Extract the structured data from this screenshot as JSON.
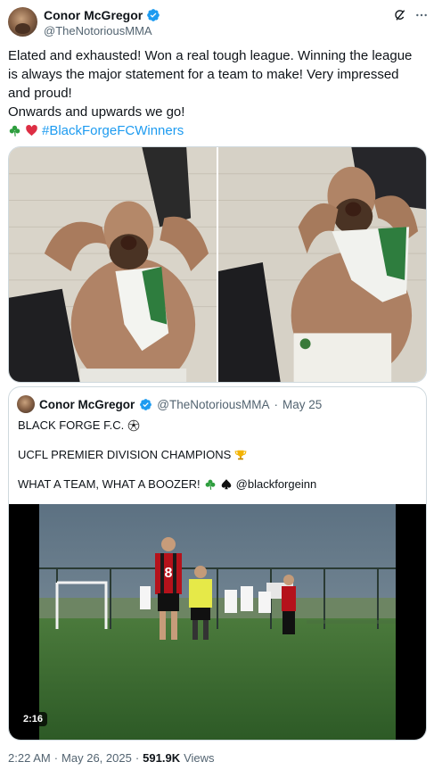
{
  "author": {
    "name": "Conor McGregor",
    "handle": "@TheNotoriousMMA",
    "verified": true
  },
  "tweet": {
    "line1": "Elated and exhausted! Won a real tough league. Winning the league is always the major statement for a team to make! Very impressed and proud!",
    "line2": "Onwards and upwards we go!",
    "hashtag": "#BlackForgeFCWinners",
    "emojis": [
      "shamrock",
      "red-heart"
    ]
  },
  "photos": [
    {
      "name": "photo-celebration-left"
    },
    {
      "name": "photo-celebration-right"
    }
  ],
  "quoted": {
    "name": "Conor McGregor",
    "handle": "@TheNotoriousMMA",
    "separator": "·",
    "date": "May 25",
    "line1": "BLACK FORGE F.C.",
    "line2": "UCFL PREMIER DIVISION CHAMPIONS",
    "line3_text": "WHAT A TEAM, WHAT A BOOZER!",
    "line3_mention": "@blackforgeinn",
    "video_duration": "2:16",
    "player_number": "8"
  },
  "footer": {
    "time": "2:22 AM",
    "sep1": "·",
    "date": "May 26, 2025",
    "sep2": "·",
    "views_count": "591.9K",
    "views_label": "Views"
  },
  "colors": {
    "accent": "#1d9bf0",
    "text": "#0f1419",
    "secondary": "#536471",
    "border": "#cfd9de"
  }
}
